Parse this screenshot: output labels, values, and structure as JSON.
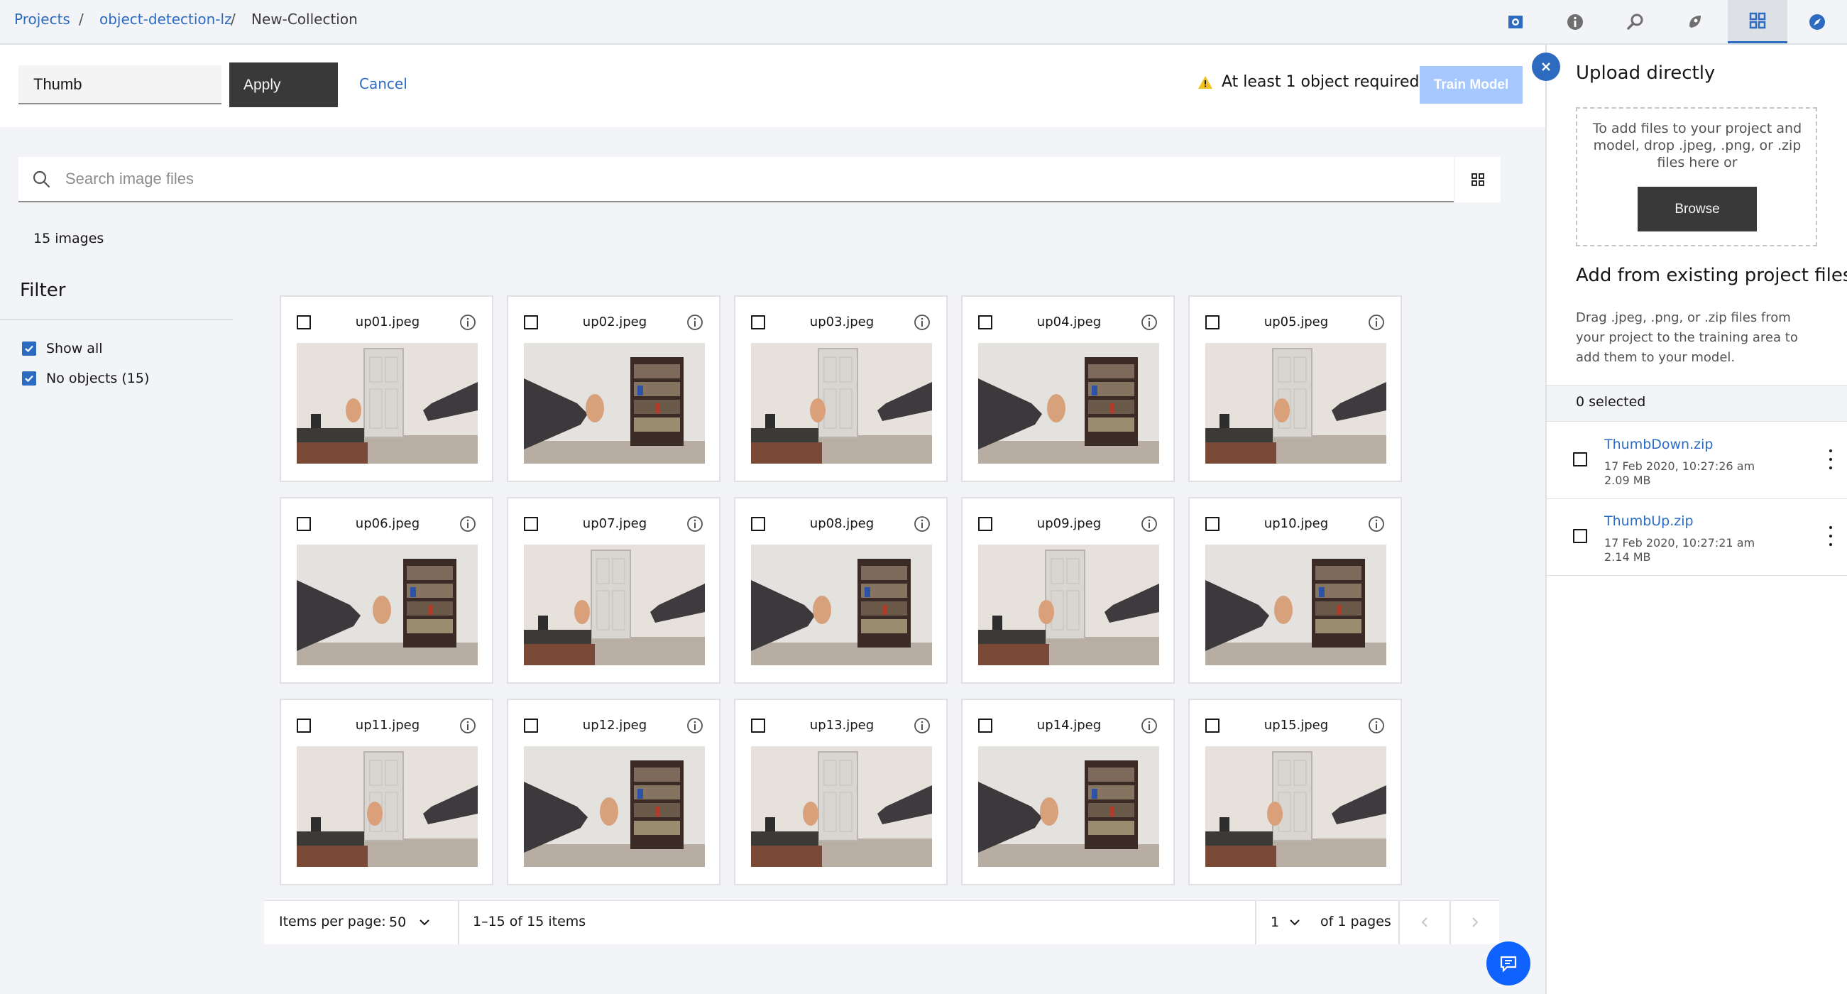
{
  "breadcrumb": {
    "projects": "Projects",
    "project": "object-detection-lz",
    "current": "New-Collection",
    "separator": "/"
  },
  "toolbar": {
    "name_value": "Thumb",
    "apply_label": "Apply",
    "cancel_label": "Cancel",
    "warning_text": "At least 1 object required",
    "train_label": "Train Model"
  },
  "search": {
    "placeholder": "Search image files"
  },
  "image_count": "15 images",
  "filter": {
    "title": "Filter",
    "show_all": "Show all",
    "no_objects": "No objects (15)"
  },
  "images": [
    {
      "name": "up01.jpeg"
    },
    {
      "name": "up02.jpeg"
    },
    {
      "name": "up03.jpeg"
    },
    {
      "name": "up04.jpeg"
    },
    {
      "name": "up05.jpeg"
    },
    {
      "name": "up06.jpeg"
    },
    {
      "name": "up07.jpeg"
    },
    {
      "name": "up08.jpeg"
    },
    {
      "name": "up09.jpeg"
    },
    {
      "name": "up10.jpeg"
    },
    {
      "name": "up11.jpeg"
    },
    {
      "name": "up12.jpeg"
    },
    {
      "name": "up13.jpeg"
    },
    {
      "name": "up14.jpeg"
    },
    {
      "name": "up15.jpeg"
    }
  ],
  "pagination": {
    "items_per_page_label": "Items per page:",
    "items_per_page_value": "50",
    "range_text": "1–15 of 15 items",
    "page_value": "1",
    "of_pages": "of 1 pages"
  },
  "right_panel": {
    "upload_title": "Upload directly",
    "drop_text": "To add files to your project and model, drop .jpeg, .png, or .zip files here or",
    "browse_label": "Browse",
    "existing_title": "Add from existing project files",
    "existing_desc": "Drag .jpeg, .png, or .zip files from your project to the training area to add them to your model.",
    "selected_text": "0 selected",
    "files": [
      {
        "name": "ThumbDown.zip",
        "date": "17 Feb 2020, 10:27:26 am",
        "size": "2.09 MB"
      },
      {
        "name": "ThumbUp.zip",
        "date": "17 Feb 2020, 10:27:21 am",
        "size": "2.14 MB"
      }
    ]
  },
  "colors": {
    "accent": "#2c6bc0",
    "primary_dark": "#393939",
    "disabled_primary": "#a6c8ff",
    "warning": "#f1c21b",
    "chat": "#0f62fe"
  },
  "icons": [
    "screenshot-icon",
    "info-icon",
    "settings-search-icon",
    "deploy-icon",
    "dashboard-icon",
    "compass-icon",
    "search-icon",
    "grid-view-icon",
    "warning-icon",
    "close-icon",
    "chevron-down-icon",
    "chevron-left-icon",
    "chevron-right-icon",
    "chat-icon",
    "overflow-menu-icon"
  ]
}
